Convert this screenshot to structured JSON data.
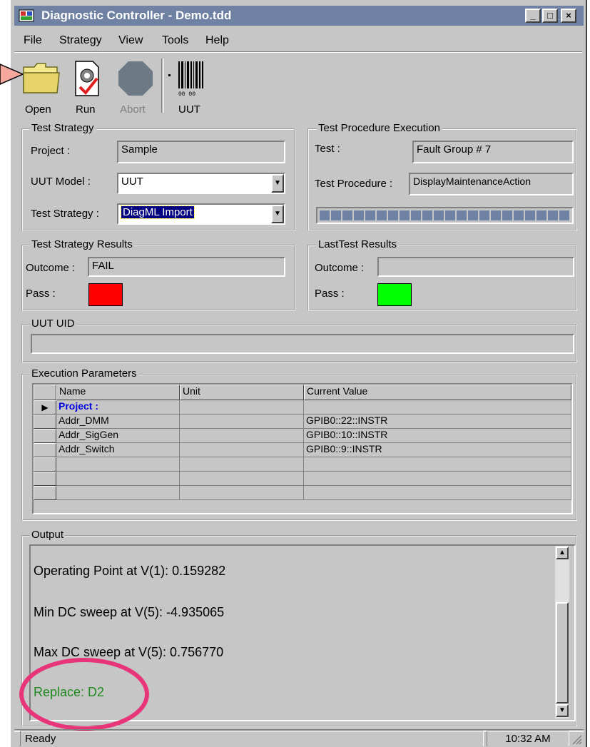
{
  "window": {
    "title": "Diagnostic Controller - Demo.tdd",
    "minimize": "_",
    "maximize": "□",
    "close": "×"
  },
  "menu": [
    "File",
    "Strategy",
    "View",
    "Tools",
    "Help"
  ],
  "toolbar": {
    "open": "Open",
    "run": "Run",
    "abort": "Abort",
    "uut": "UUT"
  },
  "test_strategy": {
    "group": "Test Strategy",
    "project_label": "Project :",
    "project_value": "Sample",
    "model_label": "UUT Model :",
    "model_value": "UUT",
    "strategy_label": "Test Strategy :",
    "strategy_value": "DiagML Import"
  },
  "test_procedure": {
    "group": "Test Procedure Execution",
    "test_label": "Test :",
    "test_value": "Fault Group # 7",
    "proc_label": "Test Procedure :",
    "proc_value": "DisplayMaintenanceAction",
    "progress": 1.0
  },
  "strategy_results": {
    "group": "Test Strategy Results",
    "outcome_label": "Outcome :",
    "outcome_value": "FAIL",
    "pass_label": "Pass :",
    "pass_color": "#ff0000"
  },
  "last_results": {
    "group": "LastTest Results",
    "outcome_label": "Outcome :",
    "outcome_value": "",
    "pass_label": "Pass :",
    "pass_color": "#00ff00"
  },
  "uut_uid": {
    "group": "UUT UID",
    "value": ""
  },
  "params": {
    "group": "Execution Parameters",
    "columns": [
      "Name",
      "Unit",
      "Current Value"
    ],
    "rows": [
      [
        "Project :",
        "",
        ""
      ],
      [
        "Addr_DMM",
        "",
        "GPIB0::22::INSTR"
      ],
      [
        "Addr_SigGen",
        "",
        "GPIB0::10::INSTR"
      ],
      [
        "Addr_Switch",
        "",
        "GPIB0::9::INSTR"
      ],
      [
        "",
        "",
        ""
      ],
      [
        "",
        "",
        ""
      ]
    ]
  },
  "output": {
    "group": "Output",
    "lines": [
      "Operating Point at V(1): 0.159282",
      "Min DC sweep at V(5): -4.935065",
      "Max DC sweep at V(5): 0.756770",
      "Replace: D2"
    ]
  },
  "status": {
    "text": "Ready",
    "time": "10:32 AM"
  },
  "colors": {
    "title_bar": "#6f82a3",
    "highlight_circle": "#e8357a",
    "arrow": "#f4a79d",
    "replace_text": "#1e8a1e",
    "project_text": "#0000e0"
  }
}
